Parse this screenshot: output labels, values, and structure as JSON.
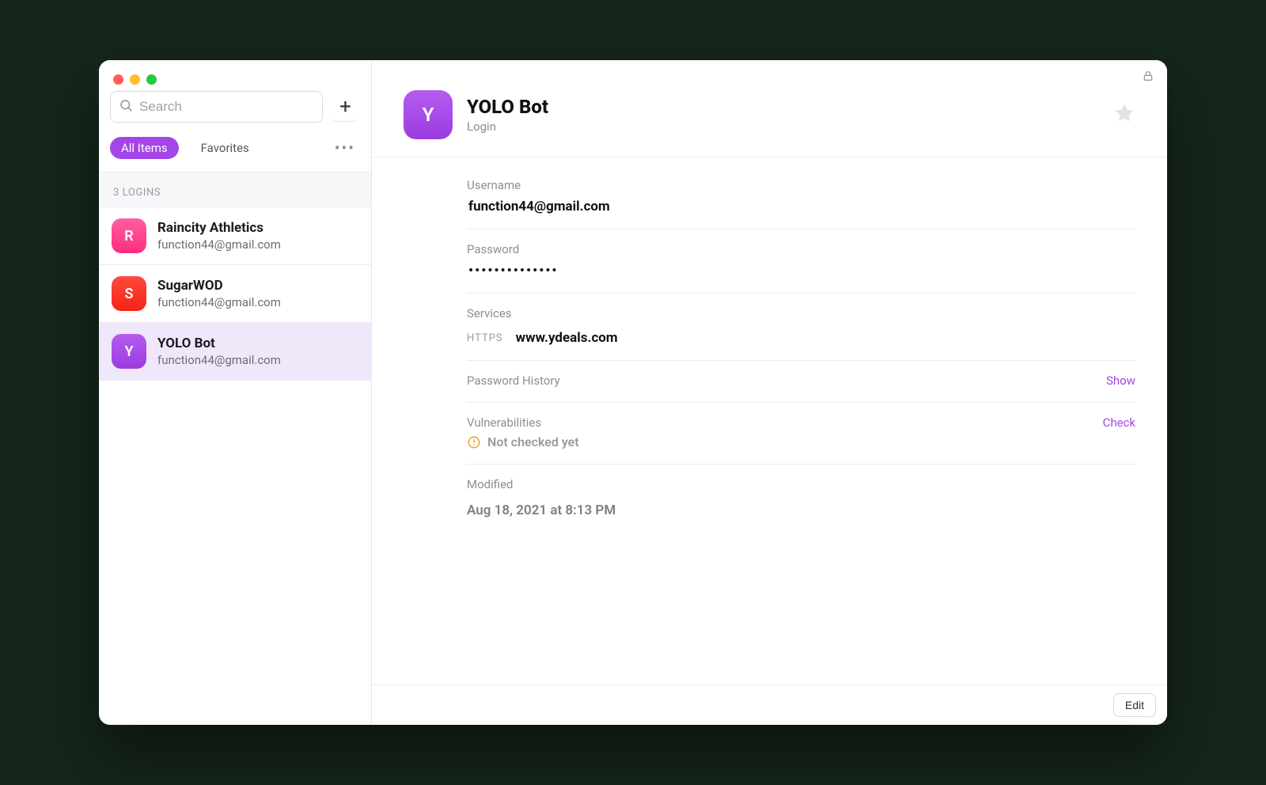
{
  "search": {
    "placeholder": "Search"
  },
  "filters": {
    "all_items": "All Items",
    "favorites": "Favorites"
  },
  "section_header": "3 LOGINS",
  "items": [
    {
      "initial": "R",
      "title": "Raincity Athletics",
      "sub": "function44@gmail.com"
    },
    {
      "initial": "S",
      "title": "SugarWOD",
      "sub": "function44@gmail.com"
    },
    {
      "initial": "Y",
      "title": "YOLO Bot",
      "sub": "function44@gmail.com"
    }
  ],
  "detail": {
    "initial": "Y",
    "title": "YOLO Bot",
    "subtitle": "Login",
    "username_label": "Username",
    "username": "function44@gmail.com",
    "password_label": "Password",
    "password_masked": "••••••••••••••",
    "services_label": "Services",
    "service_protocol": "HTTPS",
    "service_host": "www.ydeals.com",
    "history_label": "Password History",
    "history_action": "Show",
    "vuln_label": "Vulnerabilities",
    "vuln_action": "Check",
    "vuln_status": "Not checked yet",
    "modified_label": "Modified",
    "modified_value": "Aug 18, 2021 at 8:13 PM"
  },
  "footer": {
    "edit": "Edit"
  }
}
